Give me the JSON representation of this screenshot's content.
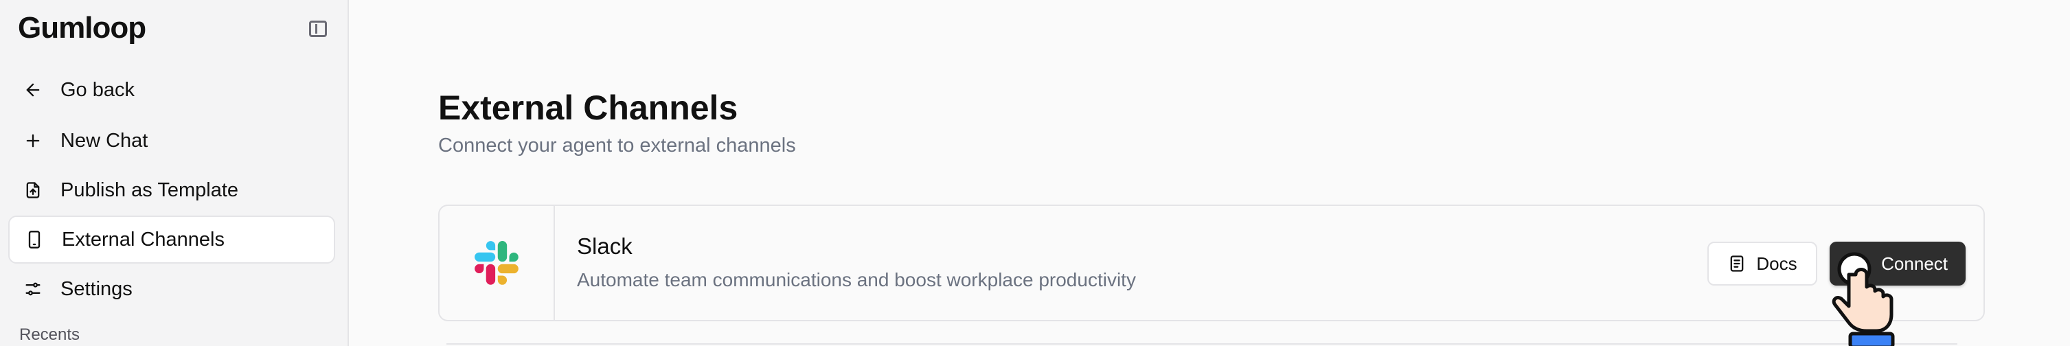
{
  "sidebar": {
    "logo": "Gumloop",
    "items": [
      {
        "label": "Go back",
        "icon": "arrow-left-icon"
      },
      {
        "label": "New Chat",
        "icon": "plus-icon"
      },
      {
        "label": "Publish as Template",
        "icon": "file-upload-icon"
      },
      {
        "label": "External Channels",
        "icon": "phone-icon",
        "active": true
      },
      {
        "label": "Settings",
        "icon": "sliders-icon"
      }
    ],
    "recents_label": "Recents"
  },
  "main": {
    "title": "External Channels",
    "subtitle": "Connect your agent to external channels",
    "channels": [
      {
        "name": "Slack",
        "description": "Automate team communications and boost workplace productivity",
        "docs_label": "Docs",
        "connect_label": "Connect"
      }
    ]
  },
  "colors": {
    "connect_button": "#2e2e2e",
    "slack_blue": "#36C5F0",
    "slack_green": "#2EB67D",
    "slack_yellow": "#ECB22E",
    "slack_red": "#E01E5A"
  }
}
